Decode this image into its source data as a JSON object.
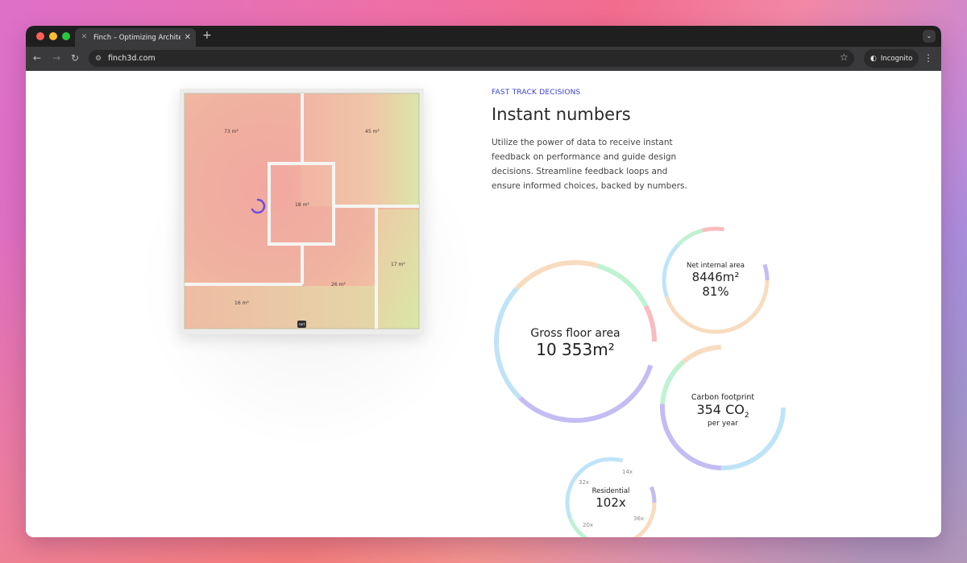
{
  "browser": {
    "tab_title": "Finch – Optimizing Architectu",
    "url": "finch3d.com",
    "incognito_label": "Incognito"
  },
  "hero": {
    "eyebrow": "FAST TRACK DECISIONS",
    "title": "Instant numbers",
    "description": "Utilize the power of data to receive instant feedback on performance and guide design decisions. Streamline feedback loops and ensure informed choices, backed by numbers."
  },
  "floor_plan": {
    "rooms": [
      {
        "label": "73 m²"
      },
      {
        "label": "45 m²"
      },
      {
        "label": "18 m²"
      },
      {
        "label": "17 m²"
      },
      {
        "label": "26 m²"
      },
      {
        "label": "16 m²"
      }
    ],
    "pin_label": "sort"
  },
  "metrics": {
    "gross": {
      "label": "Gross floor area",
      "value": "10 353m²"
    },
    "net": {
      "label": "Net internal area",
      "value": "8446m²",
      "percent": "81%"
    },
    "carbon": {
      "label": "Carbon footprint",
      "value": "354 CO",
      "subscript": "2",
      "unit": "per year"
    },
    "residential": {
      "label": "Residential",
      "value": "102x",
      "tags": [
        "14x",
        "32x",
        "20x",
        "36x"
      ]
    }
  },
  "colors": {
    "accent": "#3b3fd1",
    "ring_purple": "#c3bdf3",
    "ring_blue": "#bfe4f7",
    "ring_green": "#bff2d2",
    "ring_peach": "#f8dcc0",
    "ring_pink": "#f8bcc0"
  }
}
